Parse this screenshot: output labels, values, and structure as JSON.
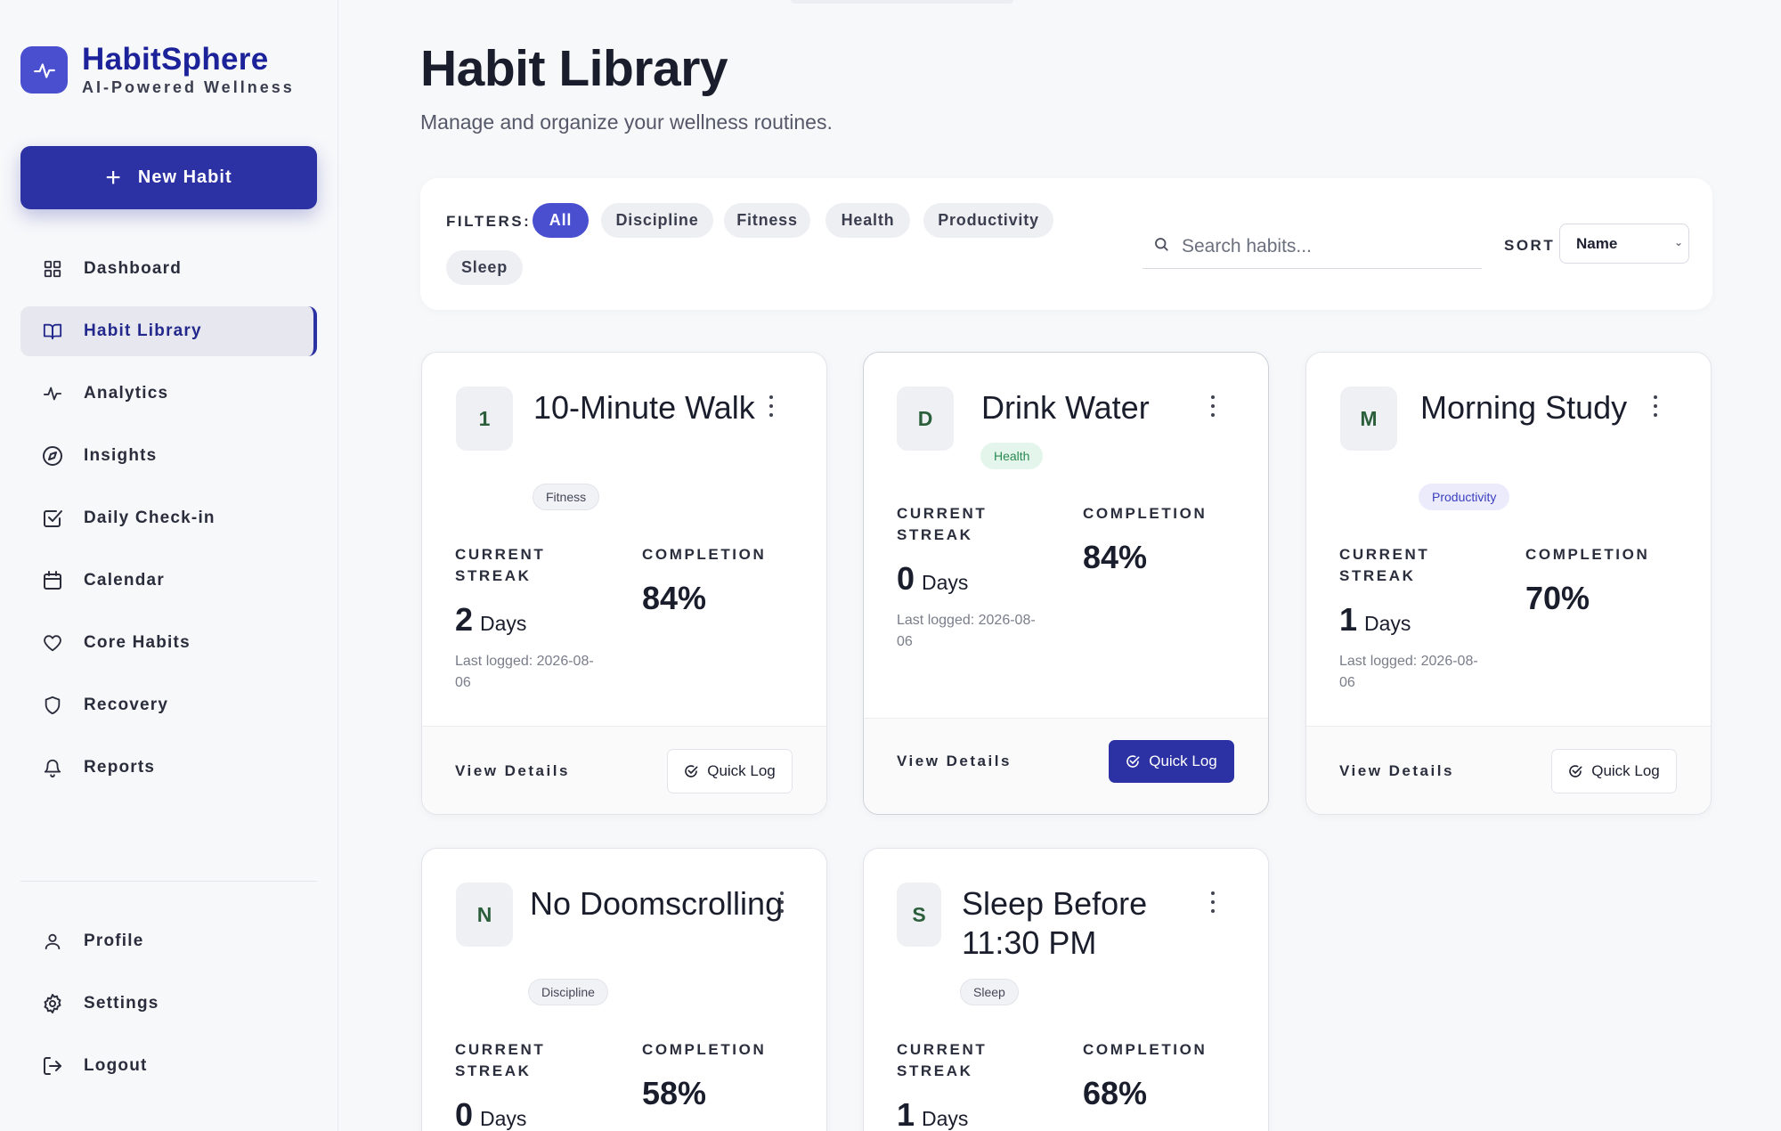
{
  "brand": {
    "name": "HabitSphere",
    "tagline": "AI-Powered Wellness"
  },
  "sidebar": {
    "new_habit_label": "New Habit",
    "items": [
      {
        "label": "Dashboard",
        "icon": "grid-icon"
      },
      {
        "label": "Habit Library",
        "icon": "book-icon",
        "active": true
      },
      {
        "label": "Analytics",
        "icon": "pulse-icon"
      },
      {
        "label": "Insights",
        "icon": "compass-icon"
      },
      {
        "label": "Daily Check-in",
        "icon": "checkbox-icon"
      },
      {
        "label": "Calendar",
        "icon": "calendar-icon"
      },
      {
        "label": "Core Habits",
        "icon": "heart-icon"
      },
      {
        "label": "Recovery",
        "icon": "shield-icon"
      },
      {
        "label": "Reports",
        "icon": "bell-icon"
      }
    ],
    "bottom_items": [
      {
        "label": "Profile",
        "icon": "user-icon"
      },
      {
        "label": "Settings",
        "icon": "gear-icon"
      },
      {
        "label": "Logout",
        "icon": "logout-icon"
      }
    ]
  },
  "page": {
    "title": "Habit Library",
    "subtitle": "Manage and organize your wellness routines."
  },
  "filters": {
    "label": "FILTERS:",
    "chips": [
      "All",
      "Discipline",
      "Fitness",
      "Health",
      "Productivity",
      "Sleep"
    ],
    "active": "All",
    "search_placeholder": "Search habits...",
    "sort_label": "SORT",
    "sort_value": "Name"
  },
  "labels": {
    "current_streak": "CURRENT STREAK",
    "completion": "COMPLETION",
    "view_details": "View Details",
    "quick_log": "Quick Log",
    "days": "Days"
  },
  "habits": [
    {
      "initial": "1",
      "title": "10-Minute Walk",
      "tag": "Fitness",
      "streak": "2",
      "completion": "84%",
      "last_logged": "Last logged: 2026-08-06"
    },
    {
      "initial": "D",
      "title": "Drink Water",
      "tag": "Health",
      "streak": "0",
      "completion": "84%",
      "last_logged": "Last logged: 2026-08-06"
    },
    {
      "initial": "M",
      "title": "Morning Study",
      "tag": "Productivity",
      "streak": "1",
      "completion": "70%",
      "last_logged": "Last logged: 2026-08-06"
    },
    {
      "initial": "N",
      "title": "No Doomscrolling",
      "tag": "Discipline",
      "streak": "0",
      "completion": "58%"
    },
    {
      "initial": "S",
      "title": "Sleep Before 11:30 PM",
      "tag": "Sleep",
      "streak": "1",
      "completion": "68%"
    }
  ],
  "colors": {
    "brand": "#1c2299",
    "primary": "#2c32a3",
    "accent": "#4a4fd0",
    "health_tag": "#2a8a52",
    "productivity_tag": "#3a3ec0"
  }
}
